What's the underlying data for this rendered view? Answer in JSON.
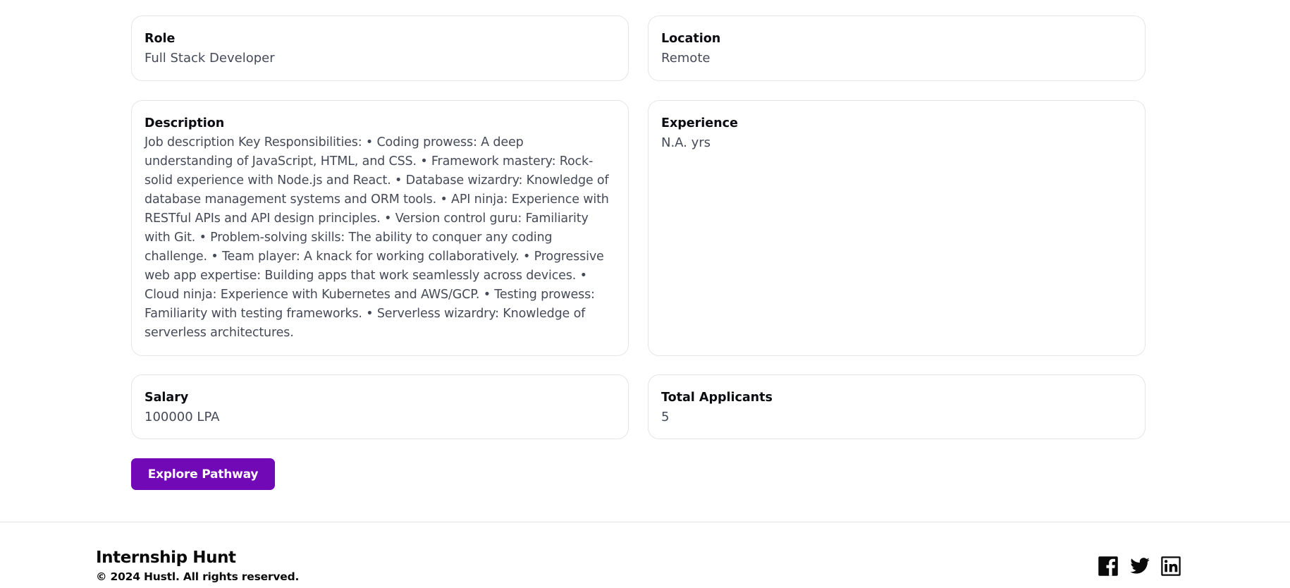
{
  "details": {
    "role": {
      "label": "Role",
      "value": "Full Stack Developer"
    },
    "location": {
      "label": "Location",
      "value": "Remote"
    },
    "description": {
      "label": "Description",
      "value": "Job description Key Responsibilities: • Coding prowess: A deep understanding of JavaScript, HTML, and CSS. • Framework mastery: Rock-solid experience with Node.js and React. • Database wizardry: Knowledge of database management systems and ORM tools. • API ninja: Experience with RESTful APIs and API design principles. • Version control guru: Familiarity with Git. • Problem-solving skills: The ability to conquer any coding challenge. • Team player: A knack for working collaboratively. • Progressive web app expertise: Building apps that work seamlessly across devices. • Cloud ninja: Experience with Kubernetes and AWS/GCP. • Testing prowess: Familiarity with testing frameworks. • Serverless wizardry: Knowledge of serverless architectures."
    },
    "experience": {
      "label": "Experience",
      "value": "N.A. yrs"
    },
    "salary": {
      "label": "Salary",
      "value": "100000 LPA"
    },
    "total_applicants": {
      "label": "Total Applicants",
      "value": "5"
    }
  },
  "actions": {
    "explore_label": "Explore Pathway"
  },
  "footer": {
    "brand": "Internship Hunt",
    "copyright": "© 2024 Hustl. All rights reserved.",
    "social_icons": [
      "facebook-icon",
      "twitter-icon",
      "linkedin-icon"
    ]
  },
  "colors": {
    "accent": "#7209b7",
    "text_primary": "#0b0b12",
    "text_secondary": "#454a57",
    "border": "#e6e6ea"
  }
}
